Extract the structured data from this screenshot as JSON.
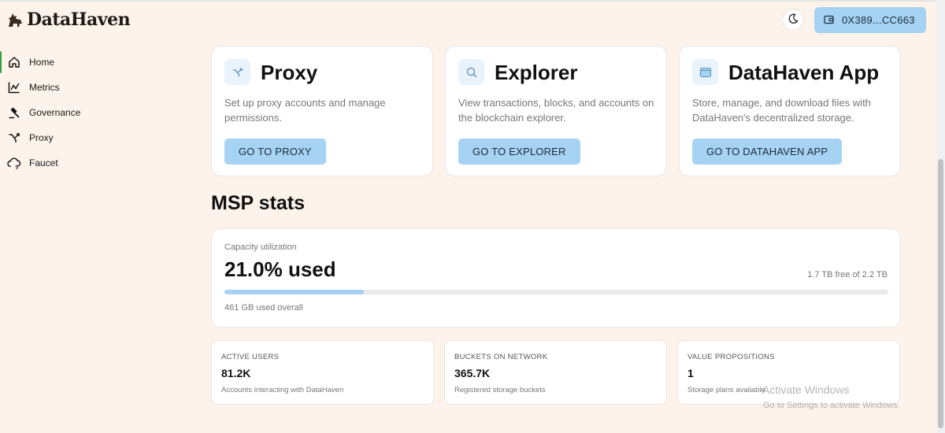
{
  "app": {
    "name": "DataHaven",
    "wallet_address": "0X389...CC663"
  },
  "sidebar": {
    "items": [
      {
        "label": "Home",
        "icon": "home-icon",
        "active": true
      },
      {
        "label": "Metrics",
        "icon": "metrics-icon"
      },
      {
        "label": "Governance",
        "icon": "gavel-icon"
      },
      {
        "label": "Proxy",
        "icon": "proxy-icon"
      },
      {
        "label": "Faucet",
        "icon": "cloud-coin-icon"
      }
    ]
  },
  "cards": [
    {
      "title": "Proxy",
      "description": "Set up proxy accounts and manage permissions.",
      "button": "GO TO PROXY",
      "icon": "proxy-icon"
    },
    {
      "title": "Explorer",
      "description": "View transactions, blocks, and accounts on the blockchain explorer.",
      "button": "GO TO EXPLORER",
      "icon": "search-icon"
    },
    {
      "title": "DataHaven App",
      "description": "Store, manage, and download files with DataHaven's decentralized storage.",
      "button": "GO TO DATAHAVEN APP",
      "icon": "app-window-icon"
    }
  ],
  "msp": {
    "title": "MSP stats",
    "capacity": {
      "label": "Capacity utilization",
      "value": "21.0% used",
      "used_fraction": 0.21,
      "free_text": "1.7 TB free of 2.2 TB",
      "note": "461 GB used overall"
    },
    "stats": [
      {
        "label": "ACTIVE USERS",
        "value": "81.2K",
        "desc": "Accounts interacting with DataHaven"
      },
      {
        "label": "BUCKETS ON NETWORK",
        "value": "365.7K",
        "desc": "Registered storage buckets"
      },
      {
        "label": "VALUE PROPOSITIONS",
        "value": "1",
        "desc": "Storage plans available"
      }
    ]
  },
  "watermark": {
    "title": "Activate Windows",
    "subtitle": "Go to Settings to activate Windows."
  },
  "colors": {
    "background": "#fdf3ea",
    "accent": "#a6d3f4",
    "active_indicator": "#2ea043"
  }
}
